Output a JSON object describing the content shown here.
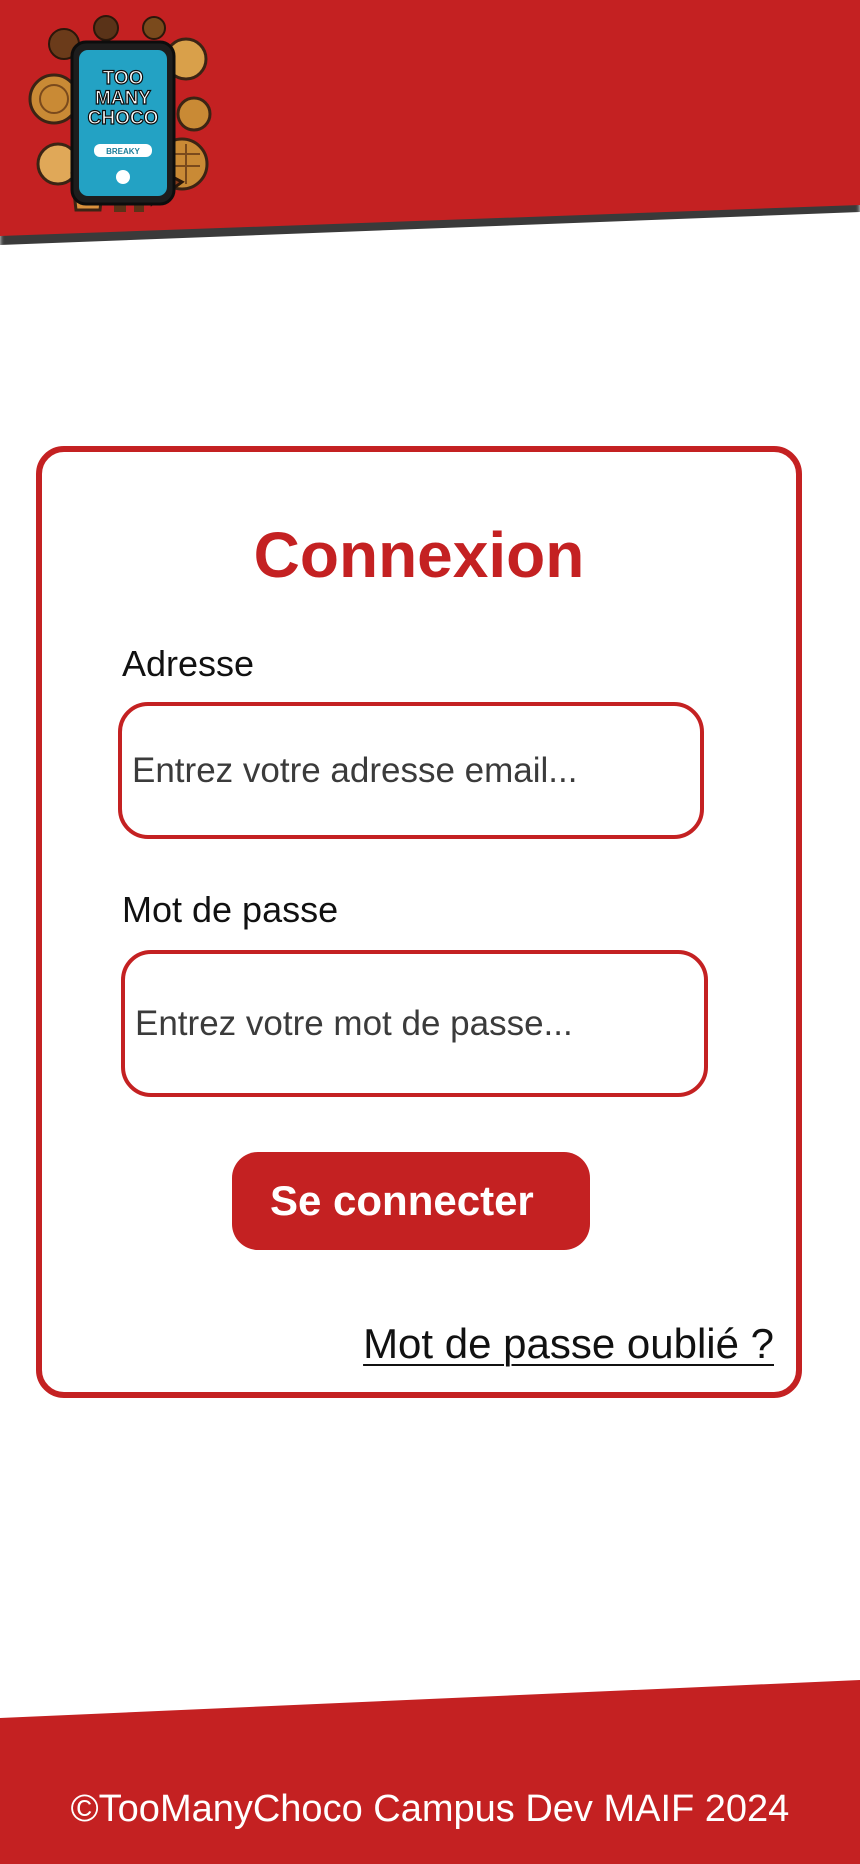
{
  "header": {
    "logo": {
      "icon": "too-many-choco-logo",
      "lines": [
        "TOO",
        "MANY",
        "CHOCO"
      ],
      "button": "BREAKY"
    }
  },
  "login": {
    "title": "Connexion",
    "email_label": "Adresse",
    "email_placeholder": "Entrez votre adresse email...",
    "email_value": "",
    "password_label": "Mot de passe",
    "password_placeholder": "Entrez votre mot de passe...",
    "password_value": "",
    "submit_label": "Se connecter",
    "forgot_label": "Mot de passe oublié ?"
  },
  "footer": {
    "text": "©TooManyChoco Campus Dev MAIF 2024"
  },
  "colors": {
    "brand_red": "#c42122",
    "white": "#ffffff",
    "text": "#111111"
  }
}
